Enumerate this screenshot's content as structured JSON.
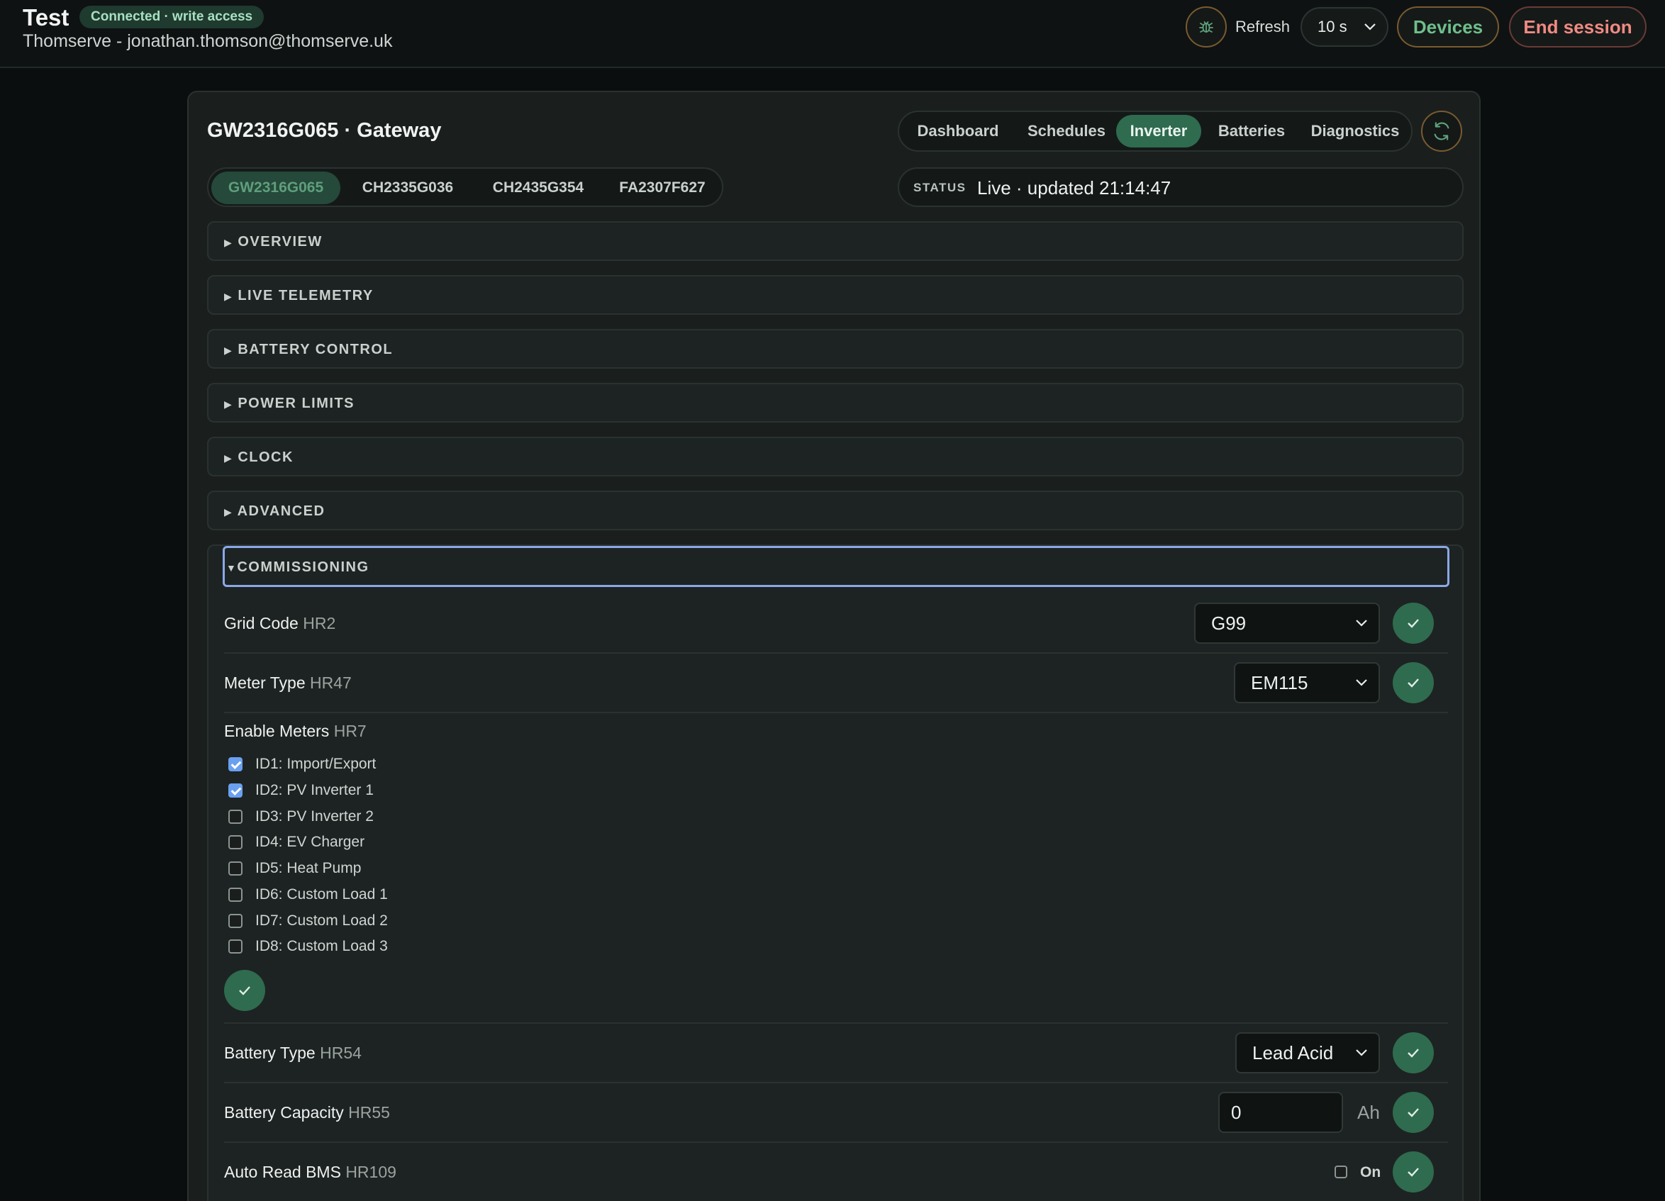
{
  "header": {
    "title": "Test",
    "connection_badge": "Connected · write access",
    "user_line": "Thomserve - jonathan.thomson@thomserve.uk",
    "refresh_label": "Refresh",
    "refresh_interval": "10 s",
    "devices_label": "Devices",
    "end_session_label": "End session"
  },
  "device": {
    "title": "GW2316G065 · Gateway",
    "tabs": [
      {
        "label": "Dashboard"
      },
      {
        "label": "Schedules"
      },
      {
        "label": "Inverter",
        "active": true
      },
      {
        "label": "Batteries"
      },
      {
        "label": "Diagnostics"
      }
    ],
    "serials": [
      {
        "label": "GW2316G065",
        "active": true
      },
      {
        "label": "CH2335G036"
      },
      {
        "label": "CH2435G354"
      },
      {
        "label": "FA2307F627"
      }
    ],
    "status_key": "STATUS",
    "status_value": "Live · updated 21:14:47"
  },
  "sections": [
    {
      "label": "OVERVIEW",
      "arrow": "▶"
    },
    {
      "label": "LIVE TELEMETRY",
      "arrow": "▶"
    },
    {
      "label": "BATTERY CONTROL",
      "arrow": "▶"
    },
    {
      "label": "POWER LIMITS",
      "arrow": "▶"
    },
    {
      "label": "CLOCK",
      "arrow": "▶"
    },
    {
      "label": "ADVANCED",
      "arrow": "▶"
    }
  ],
  "commissioning": {
    "label": "COMMISSIONING",
    "arrow": "▼",
    "grid_code": {
      "label": "Grid Code",
      "reg": "HR2",
      "value": "G99"
    },
    "meter_type": {
      "label": "Meter Type",
      "reg": "HR47",
      "value": "EM115"
    },
    "enable_meters": {
      "label": "Enable Meters",
      "reg": "HR7",
      "items": [
        {
          "label": "ID1: Import/Export",
          "checked": true
        },
        {
          "label": "ID2: PV Inverter 1",
          "checked": true
        },
        {
          "label": "ID3: PV Inverter 2",
          "checked": false
        },
        {
          "label": "ID4: EV Charger",
          "checked": false
        },
        {
          "label": "ID5: Heat Pump",
          "checked": false
        },
        {
          "label": "ID6: Custom Load 1",
          "checked": false
        },
        {
          "label": "ID7: Custom Load 2",
          "checked": false
        },
        {
          "label": "ID8: Custom Load 3",
          "checked": false
        }
      ]
    },
    "battery_type": {
      "label": "Battery Type",
      "reg": "HR54",
      "value": "Lead Acid"
    },
    "battery_capacity": {
      "label": "Battery Capacity",
      "reg": "HR55",
      "value": "0",
      "unit": "Ah"
    },
    "auto_read_bms": {
      "label": "Auto Read BMS",
      "reg": "HR109",
      "toggle_label": "On",
      "checked": false
    }
  },
  "colors": {
    "accent_green": "#2f6b4f",
    "focus_ring": "#8aa8e8",
    "danger": "#f08a82",
    "devices_text": "#6fbf8c"
  }
}
